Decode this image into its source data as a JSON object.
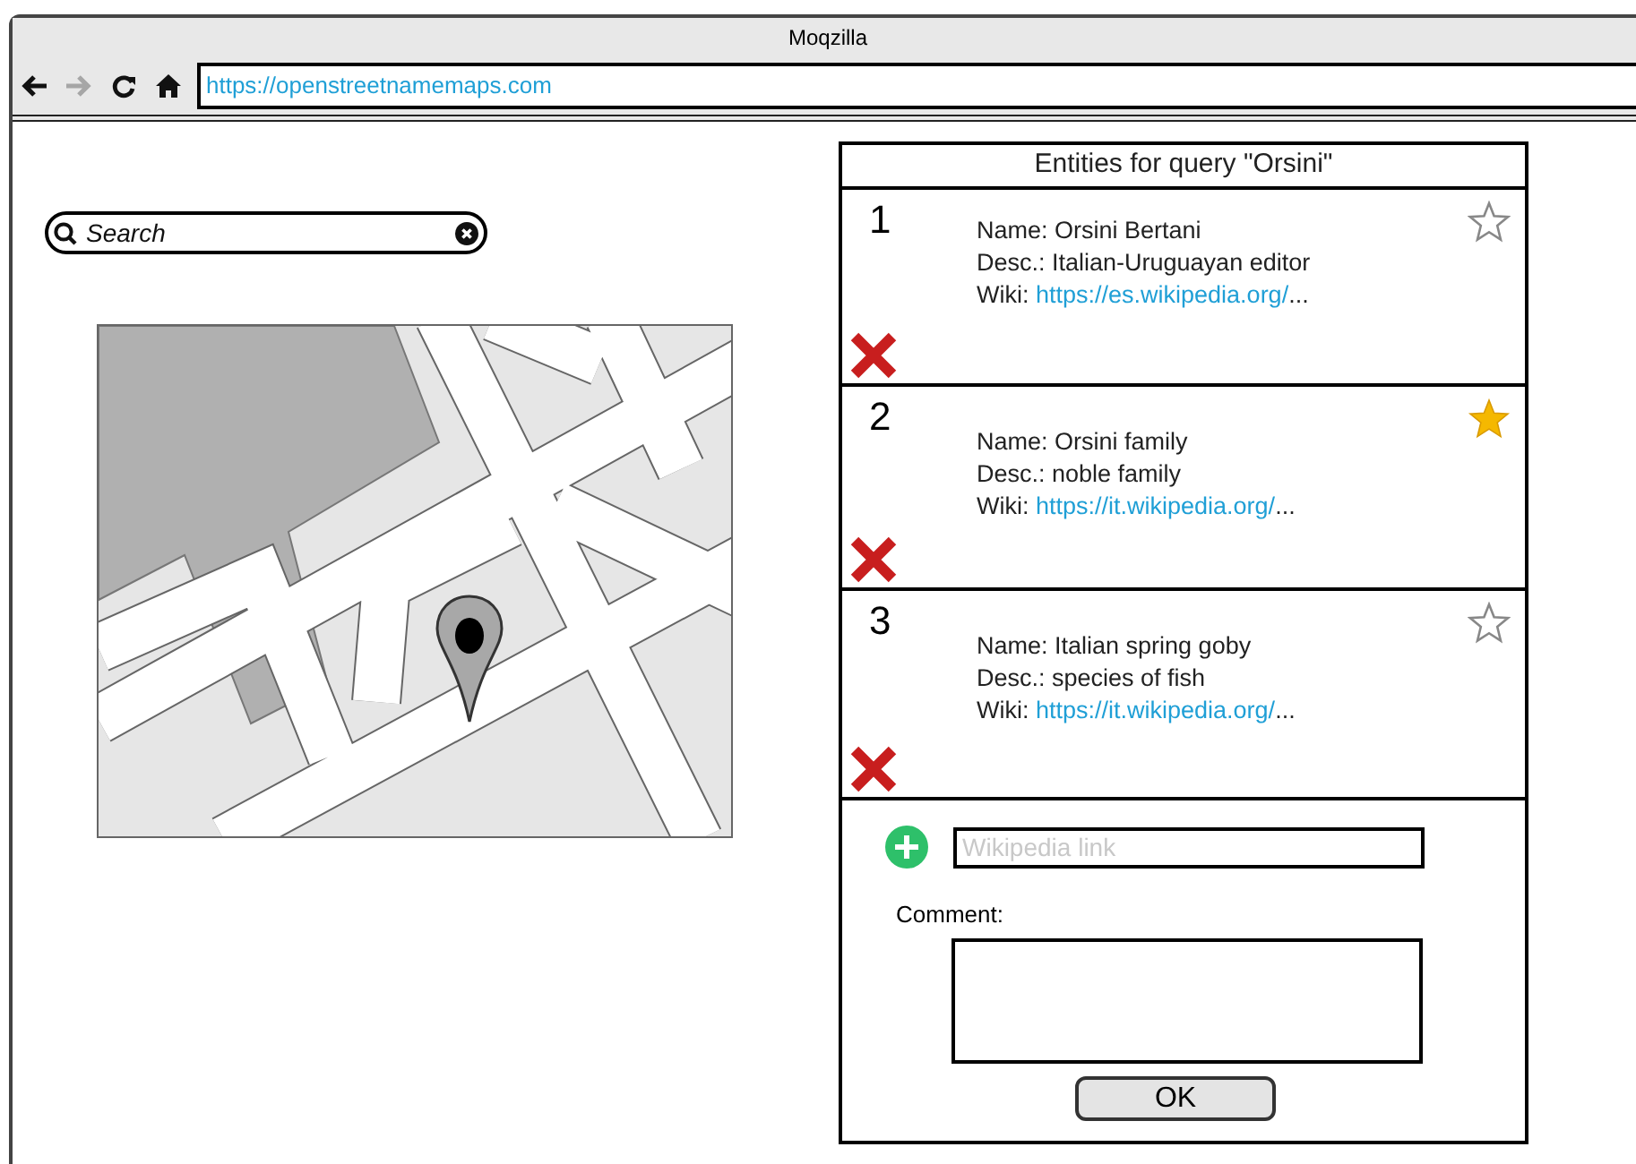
{
  "window": {
    "title": "Moqzilla"
  },
  "toolbar": {
    "nav": [
      {
        "kind": "back",
        "disabled": false
      },
      {
        "kind": "forward",
        "disabled": true
      },
      {
        "kind": "reload",
        "disabled": false
      },
      {
        "kind": "home",
        "disabled": false
      }
    ],
    "url": "https://openstreetnamemaps.com"
  },
  "search": {
    "placeholder": "Search"
  },
  "entities_panel": {
    "title": "Entities for query \"Orsini\"",
    "entities": [
      {
        "number": "1",
        "name": "Name: Orsini Bertani",
        "desc": "Desc.: Italian-Uruguayan editor",
        "wiki": {
          "prefix": "Wiki:",
          "link": "https://es.wikipedia.org/",
          "suffix": "..."
        },
        "starred": false
      },
      {
        "number": "2",
        "name": "Name: Orsini family",
        "desc": "Desc.: noble family",
        "wiki": {
          "prefix": "Wiki:",
          "link": "https://it.wikipedia.org/",
          "suffix": "..."
        },
        "starred": true
      },
      {
        "number": "3",
        "name": "Name: Italian spring goby",
        "desc": "Desc.: species of fish",
        "wiki": {
          "prefix": "Wiki:",
          "link": "https://it.wikipedia.org/",
          "suffix": "..."
        },
        "starred": false
      }
    ],
    "form": {
      "link_placeholder": "Wikipedia link",
      "comment_label": "Comment:",
      "ok_button": "OK"
    }
  }
}
